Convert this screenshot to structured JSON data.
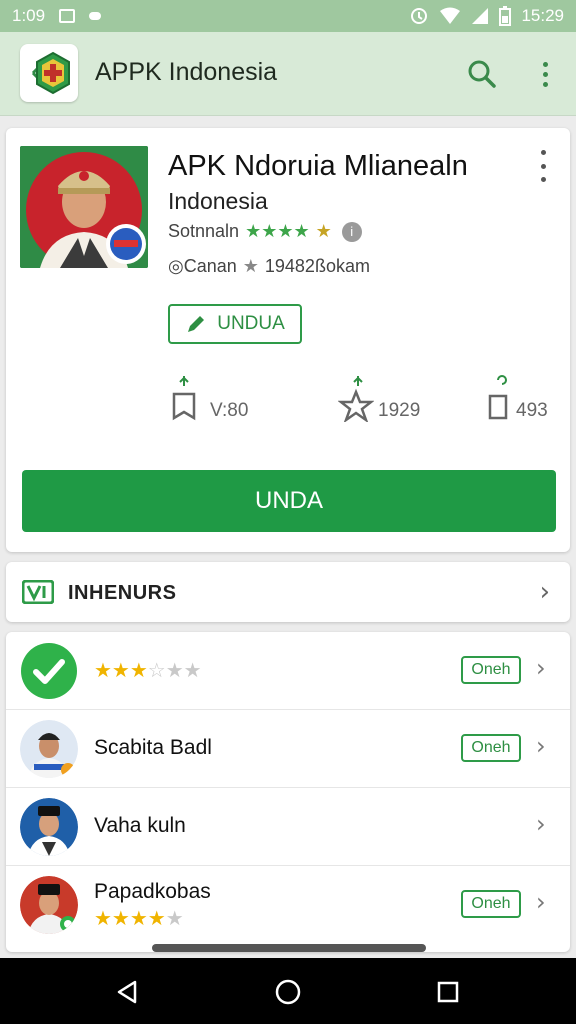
{
  "status_bar": {
    "time_left": "1:09",
    "time_right": "15:29"
  },
  "app_bar": {
    "title": "APPK Indonesia",
    "back_icon": "back-icon",
    "search_icon": "search-icon",
    "more_icon": "more-vert-icon"
  },
  "app_card": {
    "title": "APK Ndoruia Mlianealn",
    "subtitle": "Indonesia",
    "rating_label": "Sotnnaln",
    "rating_stars": "★★★★",
    "rating_star_half": "★",
    "meta_prefix": "◎Canan",
    "meta_value": "19482ßokam",
    "outline_button": "UNDUA",
    "stats": [
      {
        "icon": "bookmark-icon",
        "value": "V:80"
      },
      {
        "icon": "star-outline-icon",
        "value": "1929"
      },
      {
        "icon": "file-icon",
        "value": "493"
      }
    ],
    "primary_button": "UNDA"
  },
  "section": {
    "title": "INHENURS"
  },
  "list": [
    {
      "title": "",
      "stars": "★★★",
      "stars_off": "☆★★",
      "badge": "Oneh"
    },
    {
      "title": "Scabita Badl",
      "badge": "Oneh"
    },
    {
      "title": "Vaha kuln",
      "badge": ""
    },
    {
      "title": "Papadkobas",
      "stars": "★★★★",
      "stars_off": "★",
      "badge": "Oneh"
    }
  ],
  "colors": {
    "primary_green": "#1f9a45",
    "appbar_bg": "#d8ead7",
    "status_bg": "#9fc89f"
  }
}
